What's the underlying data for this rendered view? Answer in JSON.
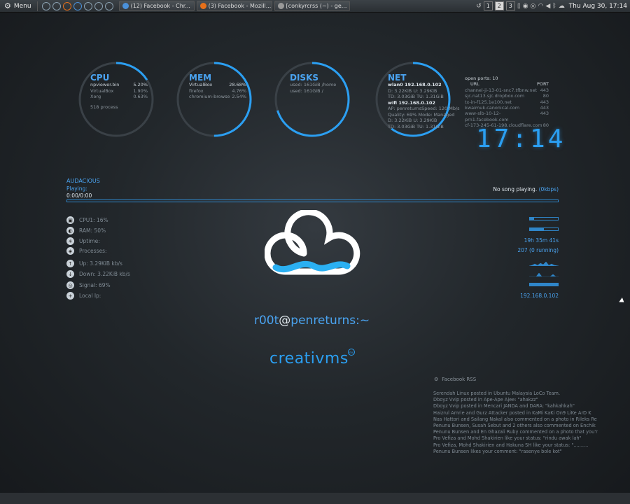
{
  "panel": {
    "menu_label": "Menu",
    "tasks": [
      {
        "label": "(12) Facebook - Chr...",
        "color": "#4a90d9"
      },
      {
        "label": "(3) Facebook - Mozill...",
        "color": "#e6701a"
      },
      {
        "label": "[conkyrcrss (~) - ge...",
        "color": "#999999"
      }
    ],
    "workspaces": [
      "1",
      "2",
      "3"
    ],
    "clock": "Thu Aug 30, 17:14"
  },
  "cpu": {
    "title": "CPU",
    "rows": [
      {
        "name": "npviewer.bin",
        "value": "5.20%"
      },
      {
        "name": "VirtualBox",
        "value": "1.90%"
      },
      {
        "name": "Xorg",
        "value": "0.63%"
      }
    ],
    "processes": "518 process",
    "percent": 16
  },
  "mem": {
    "title": "MEM",
    "rows": [
      {
        "name": "VirtualBox",
        "value": "28.68%"
      },
      {
        "name": "firefox",
        "value": "4.76%"
      },
      {
        "name": "chromium-browse",
        "value": "2.54%"
      }
    ],
    "percent": 50
  },
  "disks": {
    "title": "DISKS",
    "rows": [
      {
        "name": "used: 161GiB /home",
        "value": ""
      },
      {
        "name": "used: 161GiB /",
        "value": ""
      }
    ],
    "percent": 70
  },
  "net": {
    "title": "NET",
    "lines": [
      "wlan0 192.168.0.102",
      "D: 3.22KiB   U: 3.29KiB",
      "TD: 3.03GiB TU: 1.31GiB",
      "wifi 192.168.0.102",
      "AP: penreturnsSpeed: 120 Mb/s",
      "Quality: 69%   Mode: Managed",
      "D: 3.22KiB     U: 3.29KiB",
      "TD: 3.03GiB   TU: 1.31GiB"
    ],
    "percent": 60
  },
  "ports": {
    "header": "open ports: 10",
    "col_url": "URL",
    "col_port": "PORT",
    "rows": [
      {
        "url": "channel-ji-13-01-snc7.tfbnw.net",
        "port": "443"
      },
      {
        "url": "sjc.nat13.sjc.dropbox.com",
        "port": "80"
      },
      {
        "url": "tx-in-f125.1e100.net",
        "port": "443"
      },
      {
        "url": "kwaimuk.canonical.com",
        "port": "443"
      },
      {
        "url": "www-slb-10-12-prn1.facebook.com",
        "port": "443"
      },
      {
        "url": "cf-173-245-61-198.cloudflare.com",
        "port": "80"
      }
    ]
  },
  "big_clock": "17:14",
  "audacious": {
    "title": "AUDACIOUS",
    "playing_label": "Playing:",
    "time": "0:00/0:00",
    "status": "No song playing.",
    "bitrate": "(0kbps)"
  },
  "stats": [
    {
      "icon": "cpu-icon",
      "glyph": "▣",
      "label": "CPU1: 16%"
    },
    {
      "icon": "ram-icon",
      "glyph": "◐",
      "label": "RAM: 50%"
    },
    {
      "icon": "uptime-icon",
      "glyph": "✳",
      "label": "Uptime:"
    },
    {
      "icon": "processes-icon",
      "glyph": "◈",
      "label": "Processes:"
    },
    {
      "icon": "upload-icon",
      "glyph": "↑",
      "label": "Up: 3.29KiB kb/s"
    },
    {
      "icon": "download-icon",
      "glyph": "↓",
      "label": "Down: 3.22KiB kb/s"
    },
    {
      "icon": "signal-icon",
      "glyph": "◎",
      "label": "Signal: 69%"
    },
    {
      "icon": "local-ip-icon",
      "glyph": "+",
      "label": "Local Ip:"
    }
  ],
  "stat_values": {
    "cpu_fill": 0.16,
    "ram_fill": 0.5,
    "uptime": "19h 35m 41s",
    "processes": "207 (0 running)",
    "signal_fill": 1.0,
    "local_ip": "192.168.0.102"
  },
  "logo": {
    "prompt_user": "r00t",
    "prompt_at": "@",
    "prompt_host": "penreturns:~",
    "brand": "creativms"
  },
  "rss": {
    "title": "Facebook RSS",
    "items": [
      "Serendah Linux posted in Ubuntu Malaysia LoCo Team.",
      "Dboyz Vvip posted in Ape-Ape Ajee: \"ahakzz\"",
      "Dboyz Vvip posted in Mencari JANDA and DARA: \"kahkahkah\"",
      "Haizrul Amrie and Gurz Attacker posted in KaMi KaKi On9 LiKe ArD K",
      "Nas Hattori and Sailang Nakal also commented on a photo in Rileks Re",
      "Penunu Bunsen, Susah Sebut and 2 others also commented on Enchik",
      "Penunu Bunsen and En Ghazali Ruby commented on a photo that you'r",
      "Pro Vefiza and Mohd Shakirien like your status: \"rindu awak lah\"",
      "Pro Vefiza, Mohd Shakirien and Hakuna SH like your status: \"..........",
      "Penunu Bunsen likes your comment: \"rasenye bole kot\""
    ]
  },
  "colors": {
    "accent": "#2b9ff2",
    "ring": "#3a4147"
  }
}
